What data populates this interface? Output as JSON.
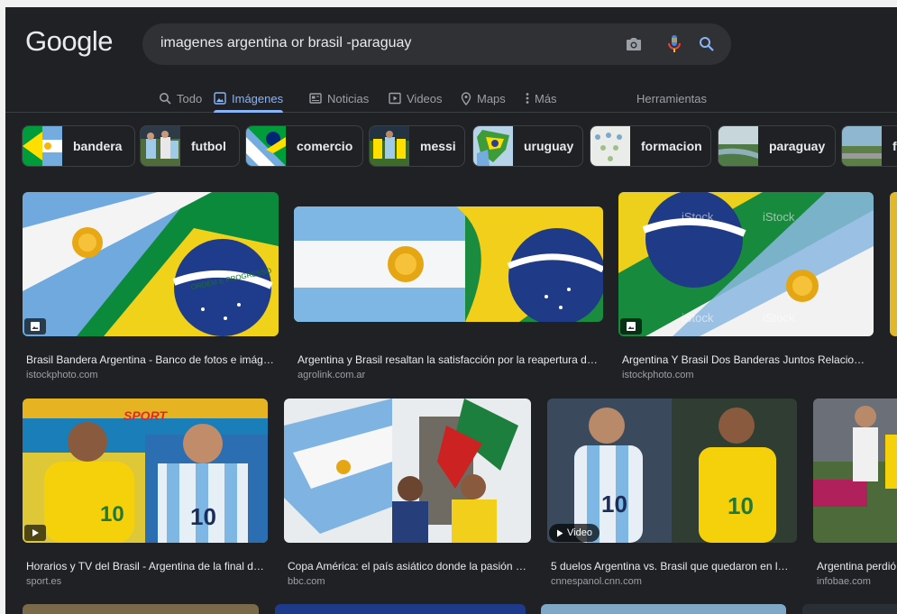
{
  "logo": "Google",
  "search": {
    "query": "imagenes argentina or brasil -paraguay"
  },
  "tabs": [
    {
      "label": "Todo",
      "icon": "search-icon"
    },
    {
      "label": "Imágenes",
      "icon": "image-icon"
    },
    {
      "label": "Noticias",
      "icon": "news-icon"
    },
    {
      "label": "Videos",
      "icon": "play-icon"
    },
    {
      "label": "Maps",
      "icon": "map-pin-icon"
    },
    {
      "label": "Más",
      "icon": "more-vertical-icon"
    }
  ],
  "tools_label": "Herramientas",
  "chips": [
    "bandera",
    "futbol",
    "comercio",
    "messi",
    "uruguay",
    "formacion",
    "paraguay",
    "f"
  ],
  "results_row1": [
    {
      "caption": "Brasil Bandera Argentina - Banco de fotos e imáge...",
      "source": "istockphoto.com",
      "badge": "image-icon"
    },
    {
      "caption": "Argentina y Brasil resaltan la satisfacción por la reapertura de ...",
      "source": "agrolink.com.ar"
    },
    {
      "caption": "Argentina Y Brasil Dos Banderas Juntos Relaciones...",
      "source": "istockphoto.com",
      "badge": "image-icon"
    }
  ],
  "results_row2": [
    {
      "caption": "Horarios y TV del Brasil - Argentina de la final de ...",
      "source": "sport.es",
      "badge": "play-icon"
    },
    {
      "caption": "Copa América: el país asiático donde la pasión p...",
      "source": "bbc.com"
    },
    {
      "caption": "5 duelos Argentina vs. Brasil que quedaron en la h...",
      "source": "cnnespanol.cnn.com",
      "badge_text": "Video"
    },
    {
      "caption": "Argentina perdió",
      "source": "infobae.com"
    }
  ],
  "image_text": {
    "brand": "SPORT",
    "istock": "iStock",
    "motto": "ORDEM E PROGRESSO",
    "jersey1": "10",
    "jersey2": "10"
  },
  "colors": {
    "background": "#202124",
    "accent": "#8ab4f8",
    "text": "#e8eaed",
    "muted": "#9aa0a6"
  }
}
